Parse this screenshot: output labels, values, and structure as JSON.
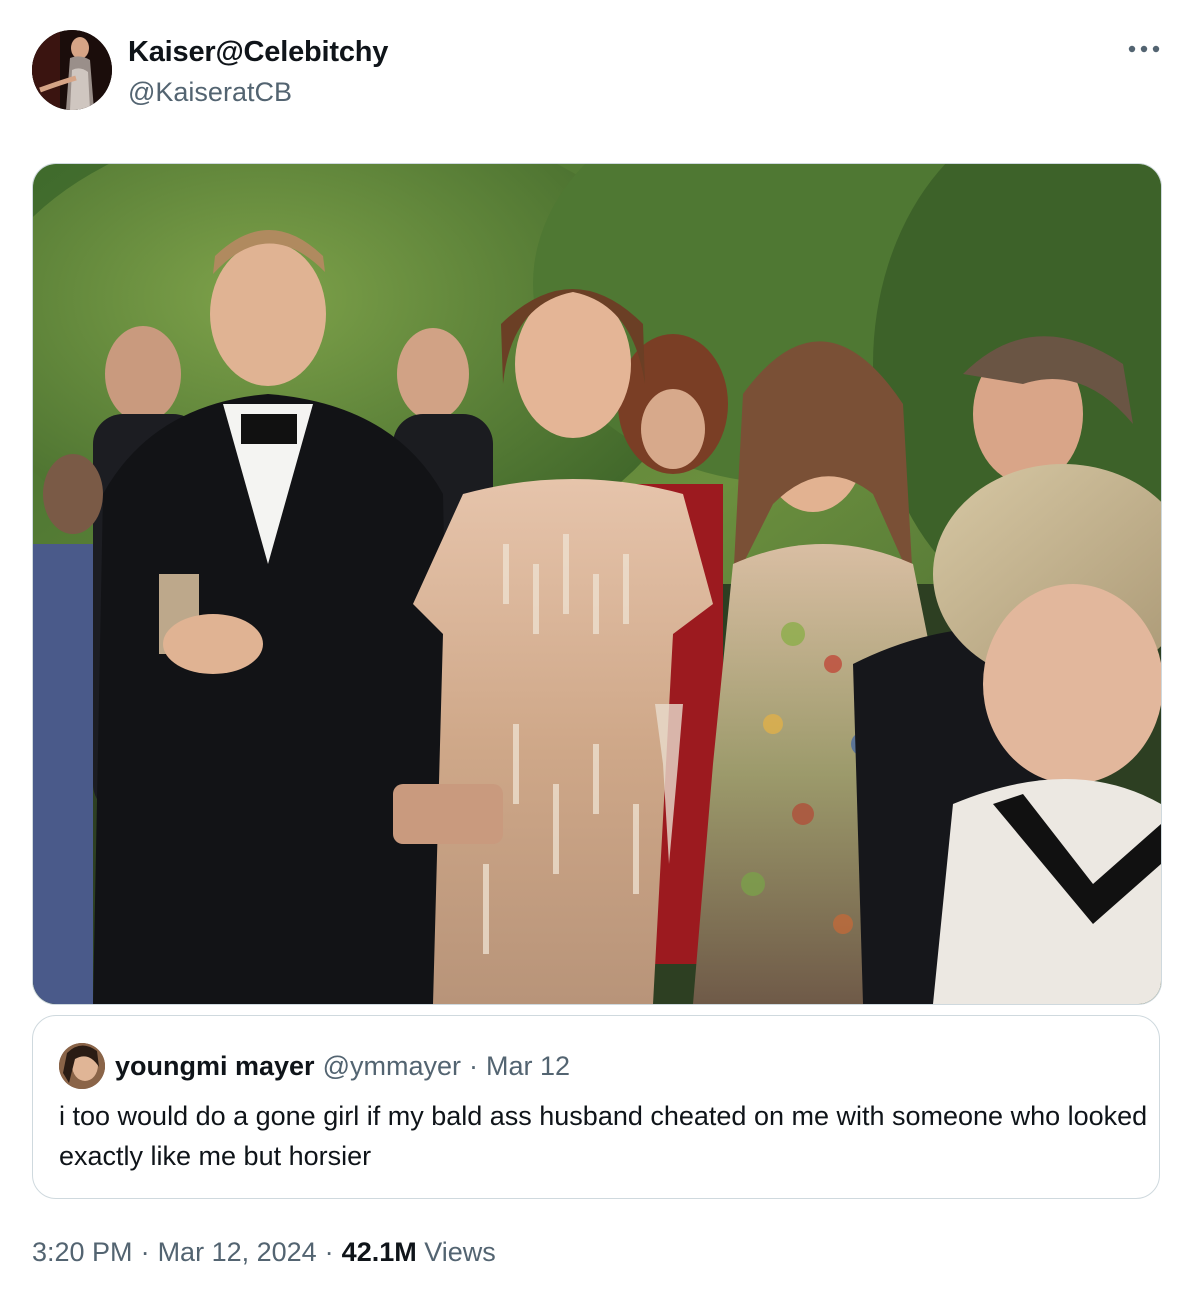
{
  "author": {
    "display_name": "Kaiser@Celebitchy",
    "handle": "@KaiseratCB"
  },
  "more_icon": "more-horizontal-icon",
  "quoted_tweet": {
    "display_name": "youngmi mayer",
    "handle": "@ymmayer",
    "separator": "·",
    "date": "Mar 12",
    "text": "i too would do a gone girl if my bald ass husband cheated on me with someone who looked exactly like me but horsier"
  },
  "meta": {
    "time": "3:20 PM",
    "separator": "·",
    "date": "Mar 12, 2024",
    "views_count": "42.1M",
    "views_label": "Views"
  },
  "colors": {
    "text_primary": "#0f1419",
    "text_secondary": "#536471",
    "border": "#cfd9de"
  }
}
